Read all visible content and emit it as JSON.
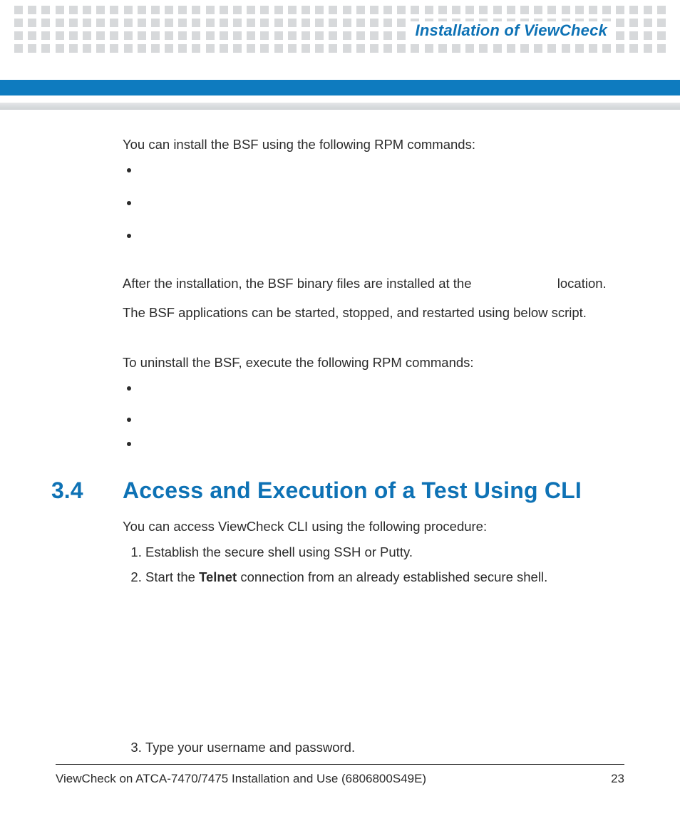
{
  "header": {
    "title": "Installation of ViewCheck"
  },
  "body": {
    "p_install_intro": "You can install the BSF using the following RPM commands:",
    "p_after_install_a": "After the installation, the BSF binary files are installed at the",
    "p_after_install_b": "location.",
    "p_start_stop": "The BSF applications can be started, stopped, and restarted using below script.",
    "p_uninstall_intro": "To uninstall the BSF, execute the following RPM commands:"
  },
  "section": {
    "number": "3.4",
    "title": "Access and Execution of a Test Using CLI",
    "intro": "You can access ViewCheck CLI using the following procedure:",
    "steps": {
      "s1": "Establish the secure shell using SSH or Putty.",
      "s2a": "Start the ",
      "s2b": "Telnet",
      "s2c": " connection from an already established secure shell.",
      "s3": "Type your username and password."
    }
  },
  "footer": {
    "doc": "ViewCheck on ATCA-7470/7475 Installation and Use (6806800S49E)",
    "page": "23"
  }
}
